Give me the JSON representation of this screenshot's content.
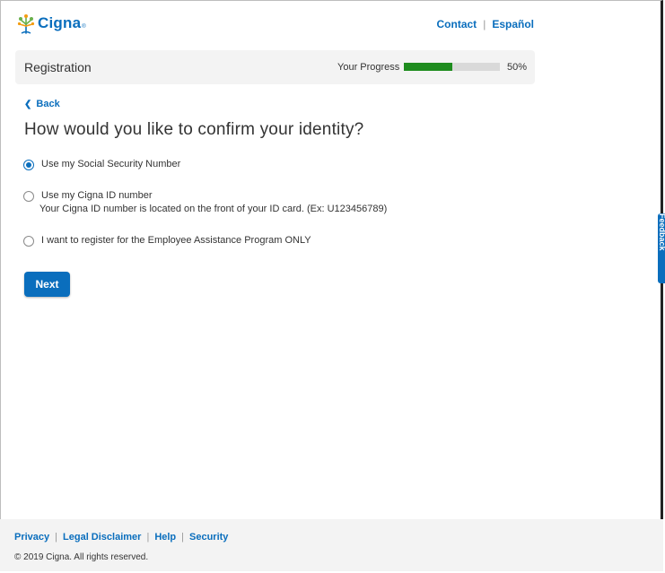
{
  "header": {
    "brand": "Cigna",
    "brand_mark": "®",
    "links": [
      "Contact",
      "Español"
    ]
  },
  "progress": {
    "title": "Registration",
    "label": "Your Progress",
    "value": 0.5,
    "percent_text": "50%",
    "fill_color": "#1e8c1e"
  },
  "nav": {
    "back_label": "Back"
  },
  "page": {
    "question": "How would you like to confirm your identity?"
  },
  "options": [
    {
      "label": "Use my Social Security Number",
      "checked": true
    },
    {
      "label": "Use my Cigna ID number",
      "sub": "Your Cigna ID number is located on the front of your ID card. (Ex: U123456789)",
      "checked": false
    },
    {
      "label": "I want to register for the Employee Assistance Program ONLY",
      "checked": false
    }
  ],
  "actions": {
    "next_label": "Next"
  },
  "feedback_tab": {
    "label": "Feedback"
  },
  "footer": {
    "links": [
      "Privacy",
      "Legal Disclaimer",
      "Help",
      "Security"
    ],
    "copyright": "© 2019 Cigna. All rights reserved."
  },
  "colors": {
    "accent": "#0a6ebd",
    "bar_bg": "#f3f3f3"
  }
}
